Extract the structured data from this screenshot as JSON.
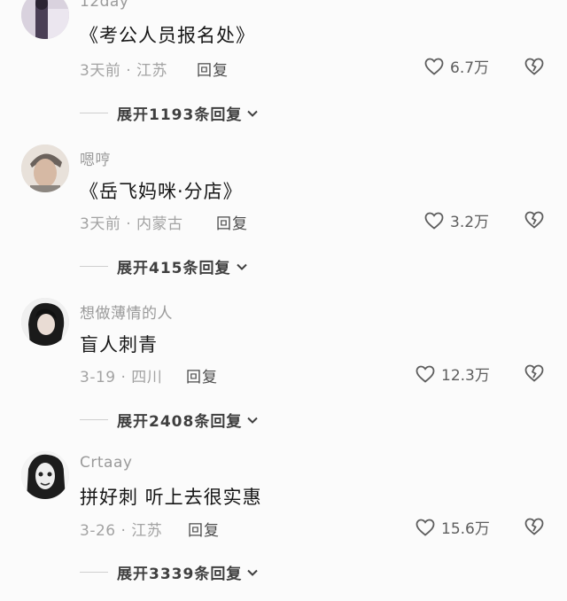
{
  "comments": [
    {
      "username": "12day",
      "text": "《考公人员报名处》",
      "meta": "3天前 · 江苏",
      "reply_label": "回复",
      "likes": "6.7万",
      "expand": "展开1193条回复"
    },
    {
      "username": "嗯哼",
      "text": "《岳飞妈咪·分店》",
      "meta": "3天前 · 内蒙古",
      "reply_label": "回复",
      "likes": "3.2万",
      "expand": "展开415条回复"
    },
    {
      "username": "想做薄情的人",
      "text": "盲人刺青",
      "meta": "3-19 · 四川",
      "reply_label": "回复",
      "likes": "12.3万",
      "expand": "展开2408条回复"
    },
    {
      "username": "Crtaay",
      "text": "拼好刺 听上去很实惠",
      "meta": "3-26 · 江苏",
      "reply_label": "回复",
      "likes": "15.6万",
      "expand": "展开3339条回复"
    }
  ]
}
